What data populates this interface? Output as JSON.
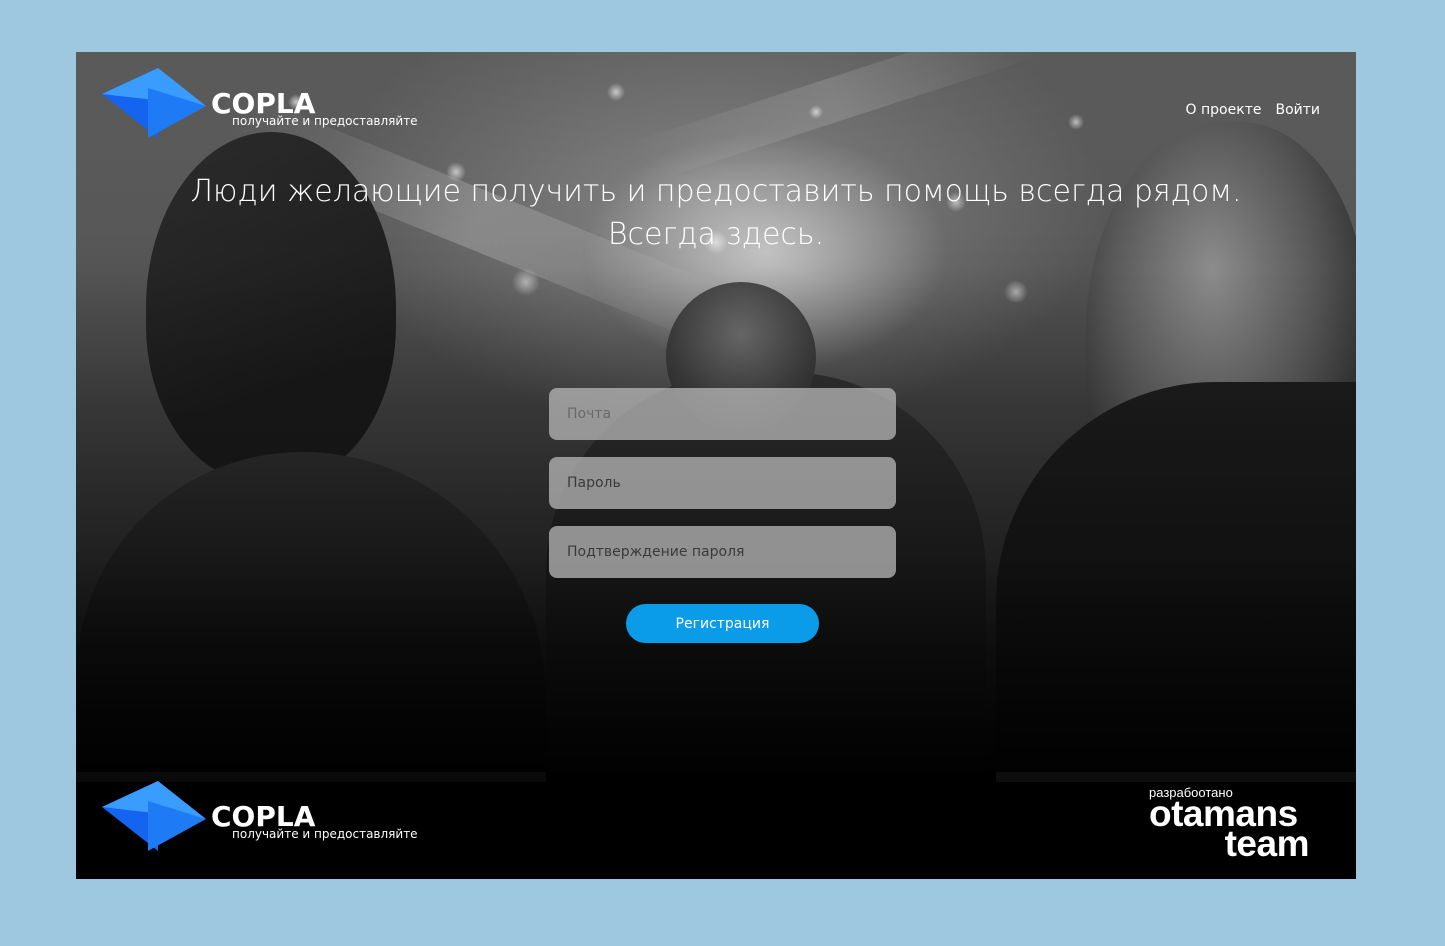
{
  "header": {
    "logo": {
      "brand": "COPLA",
      "tagline": "получайте и предоставляйте"
    },
    "nav": [
      {
        "label": "О проекте"
      },
      {
        "label": "Войти"
      }
    ]
  },
  "hero": {
    "headline_line1": "Люди желающие получить и предоставить помощь всегда рядом.",
    "headline_line2": "Всегда здесь."
  },
  "form": {
    "email_placeholder": "Почта",
    "password_placeholder": "Пароль",
    "confirm_placeholder": "Подтверждение пароля",
    "submit_label": "Регистрация"
  },
  "footer": {
    "logo": {
      "brand": "COPLA",
      "tagline": "получайте и предоставляйте"
    },
    "developer": {
      "label": "разрабоотано",
      "name_line1": "otamans",
      "name_line2": "team"
    }
  },
  "colors": {
    "page_background": "#9dc8e0",
    "accent": "#0a9ce8",
    "logo_blue_light": "#3a9cff",
    "logo_blue_dark": "#1464f0"
  }
}
